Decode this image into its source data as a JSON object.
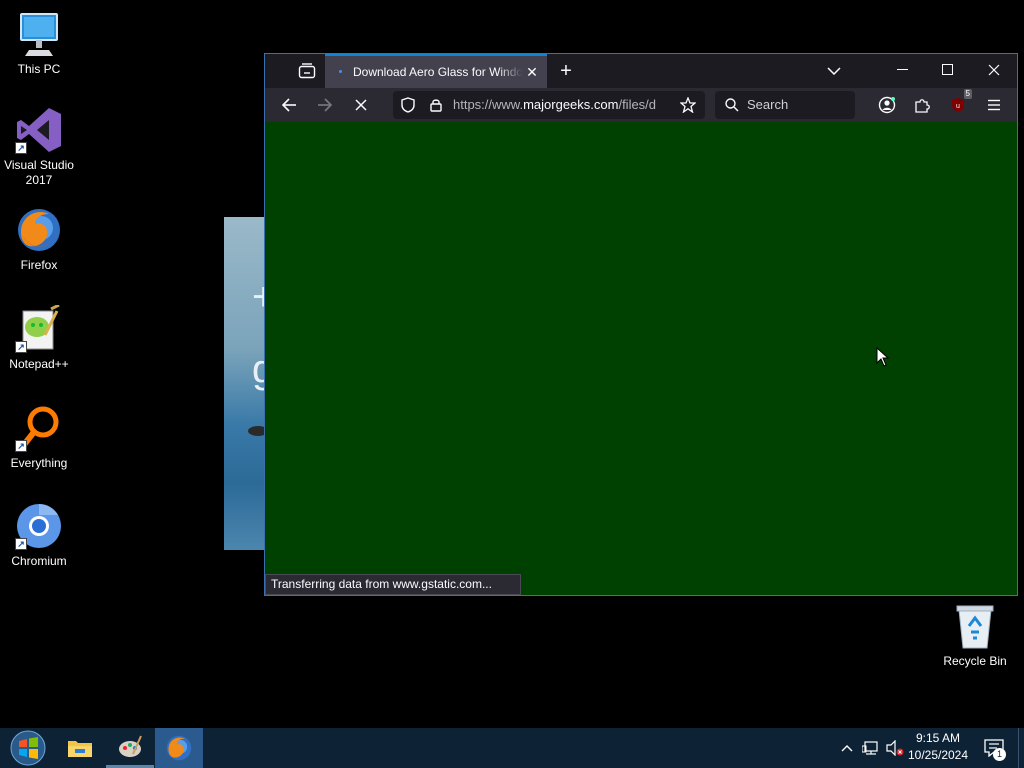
{
  "desktop": {
    "icons": [
      {
        "label": "This PC",
        "icon": "computer-icon"
      },
      {
        "label": "Visual Studio 2017",
        "icon": "visual-studio-icon"
      },
      {
        "label": "Firefox",
        "icon": "firefox-icon"
      },
      {
        "label": "Notepad++",
        "icon": "notepadpp-icon"
      },
      {
        "label": "Everything",
        "icon": "everything-search-icon"
      },
      {
        "label": "Chromium",
        "icon": "chromium-icon"
      },
      {
        "label": "Recycle Bin",
        "icon": "recycle-bin-icon"
      }
    ]
  },
  "browser": {
    "tab": {
      "title": "Download Aero Glass for Windows"
    },
    "url": {
      "prefix": "https://www.",
      "host": "majorgeeks.com",
      "path": "/files/d"
    },
    "search": {
      "placeholder": "Search"
    },
    "extension_badge": "5",
    "status_text": "Transferring data from www.gstatic.com...",
    "content_color": "#004000",
    "accent_color": "#0b84d9"
  },
  "taskbar": {
    "clock": {
      "time": "9:15 AM",
      "date": "10/25/2024"
    },
    "notification_count": "1"
  }
}
